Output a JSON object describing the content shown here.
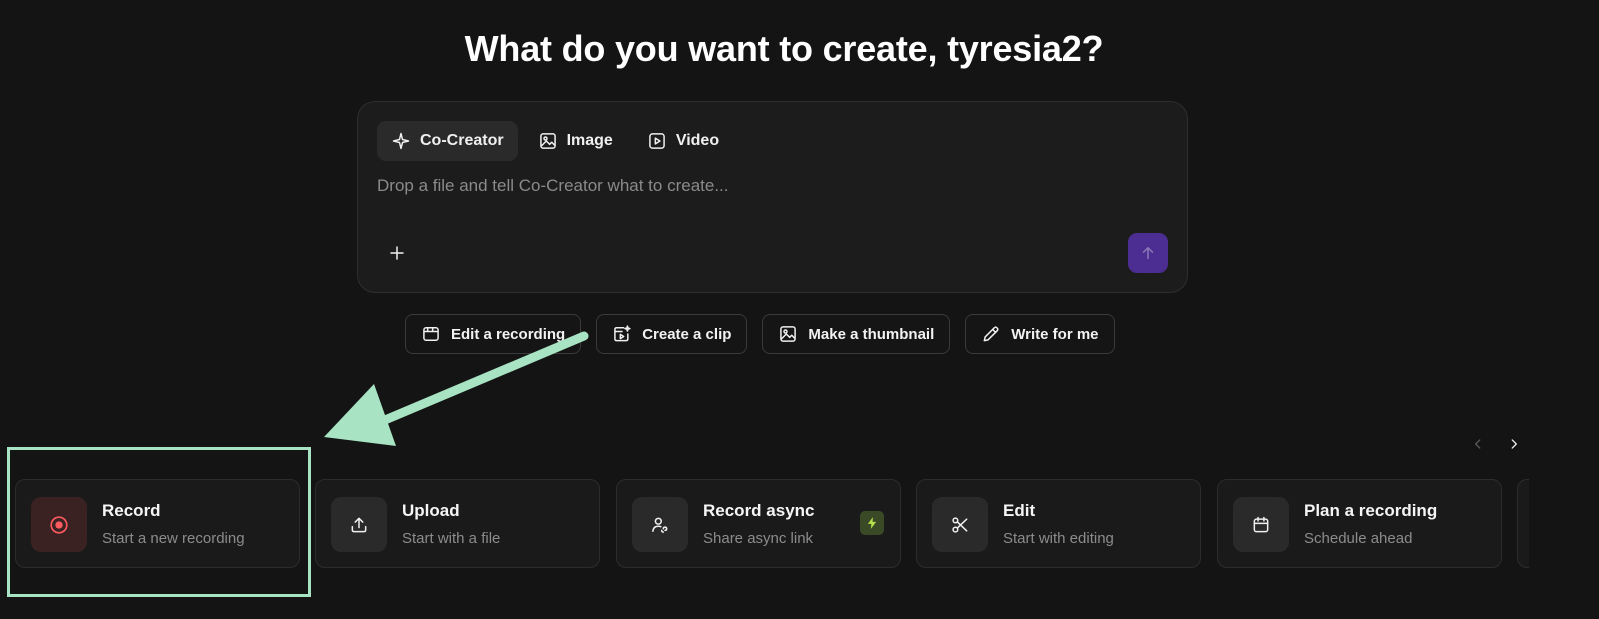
{
  "header": {
    "title": "What do you want to create, tyresia2?"
  },
  "composer": {
    "tabs": [
      {
        "label": "Co-Creator",
        "icon": "sparkle-icon",
        "active": true
      },
      {
        "label": "Image",
        "icon": "image-icon",
        "active": false
      },
      {
        "label": "Video",
        "icon": "video-play-icon",
        "active": false
      }
    ],
    "placeholder": "Drop a file and tell Co-Creator what to create...",
    "send_color": "#4c2d91"
  },
  "suggestions": [
    {
      "label": "Edit a recording",
      "icon": "film-edit-icon"
    },
    {
      "label": "Create a clip",
      "icon": "clip-sparkle-icon"
    },
    {
      "label": "Make a thumbnail",
      "icon": "thumbnail-image-icon"
    },
    {
      "label": "Write for me",
      "icon": "pencil-icon"
    }
  ],
  "cards": [
    {
      "title": "Record",
      "subtitle": "Start a new recording",
      "icon": "record-icon"
    },
    {
      "title": "Upload",
      "subtitle": "Start with a file",
      "icon": "upload-icon"
    },
    {
      "title": "Record async",
      "subtitle": "Share async link",
      "icon": "async-user-icon",
      "badge_icon": "lightning-icon"
    },
    {
      "title": "Edit",
      "subtitle": "Start with editing",
      "icon": "scissors-icon"
    },
    {
      "title": "Plan a recording",
      "subtitle": "Schedule ahead",
      "icon": "calendar-icon"
    }
  ],
  "colors": {
    "background": "#141414",
    "accent_purple": "#4c2d91",
    "record_red": "#ff5a5f",
    "annotation_green": "#a8e4c3",
    "badge_green": "#b6e34a"
  }
}
